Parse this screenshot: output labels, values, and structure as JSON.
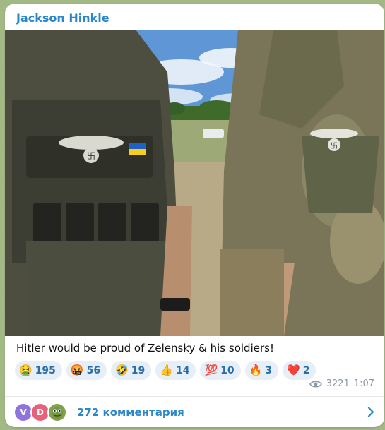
{
  "post": {
    "channel_name": "Jackson Hinkle",
    "text": "Hitler would be proud of Zelensky & his soldiers!",
    "views": "3221",
    "time": "1:07"
  },
  "reactions": [
    {
      "emoji": "🤮",
      "count": "195"
    },
    {
      "emoji": "🤬",
      "count": "56"
    },
    {
      "emoji": "🤣",
      "count": "19"
    },
    {
      "emoji": "👍",
      "count": "14"
    },
    {
      "emoji": "💯",
      "count": "10"
    },
    {
      "emoji": "🔥",
      "count": "3"
    },
    {
      "emoji": "❤️",
      "count": "2"
    }
  ],
  "comments": {
    "label": "272 комментария",
    "avatars": [
      "V",
      "D",
      ""
    ]
  },
  "colors": {
    "accent": "#2a87c8",
    "reaction_bg": "#e6eff8",
    "meta": "#8c97a3"
  },
  "icons": {
    "views": "eye-icon",
    "open_comments": "chevron-right-icon"
  }
}
